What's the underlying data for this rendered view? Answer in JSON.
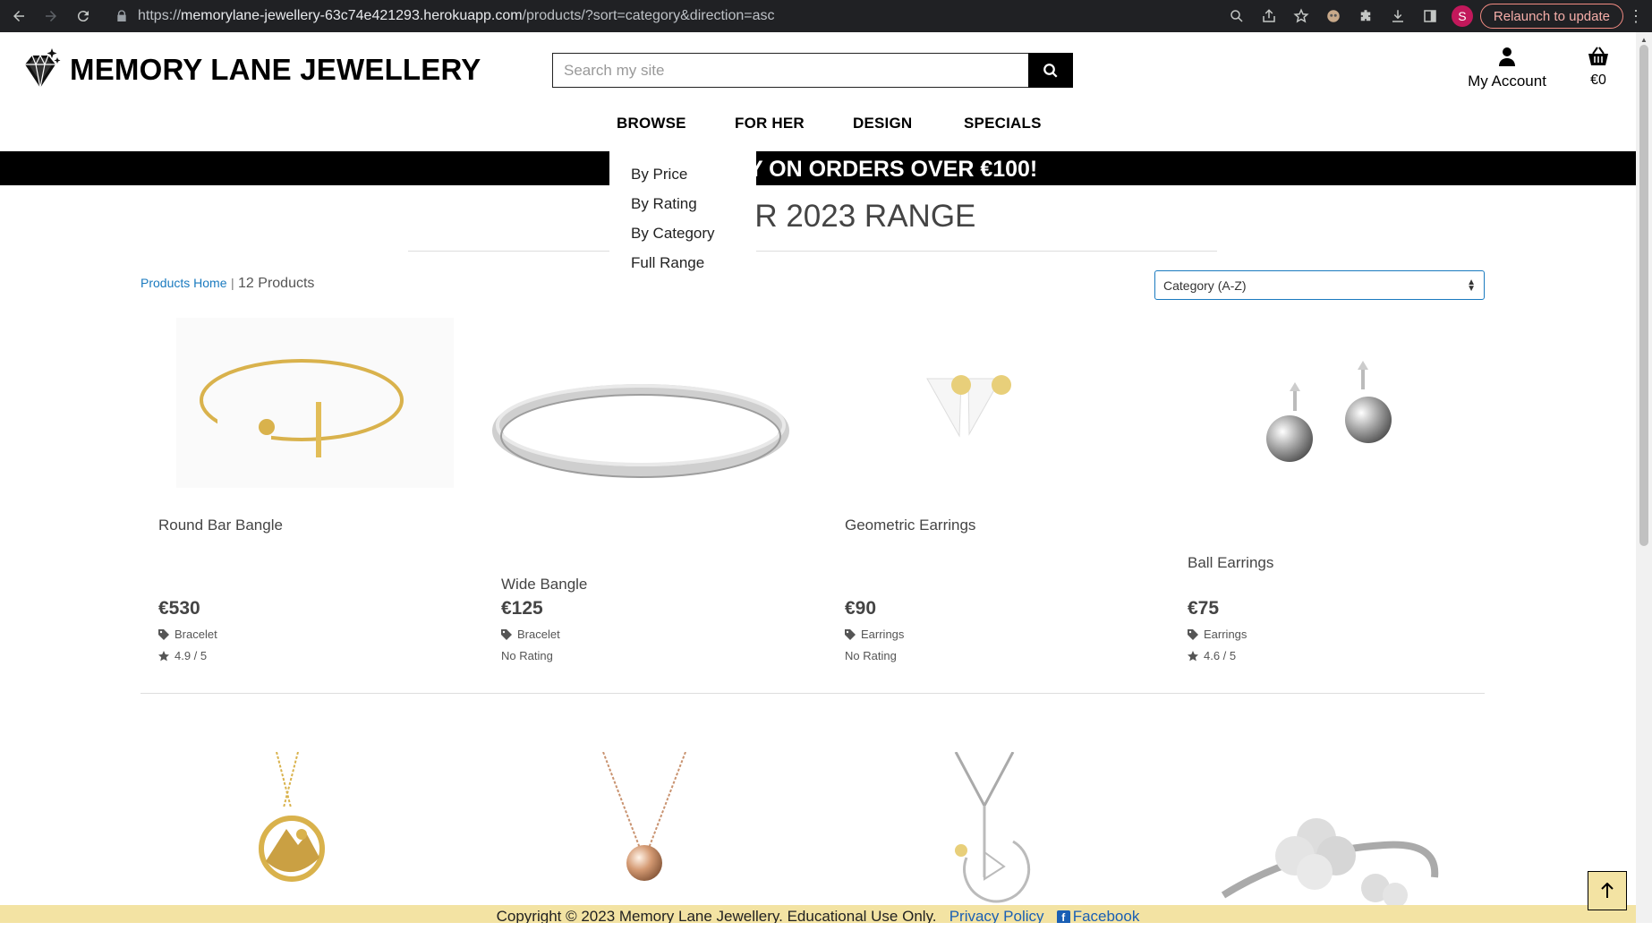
{
  "browser": {
    "url_scheme": "https://",
    "url_host": "memorylane-jewellery-63c74e421293.herokuapp.com",
    "url_path": "/products/?sort=category&direction=asc",
    "profile_initial": "S",
    "relaunch_label": "Relaunch to update"
  },
  "header": {
    "brand": "MEMORY LANE JEWELLERY",
    "search_placeholder": "Search my site",
    "account_label": "My Account",
    "basket_total": "€0"
  },
  "nav": {
    "items": [
      "BROWSE",
      "FOR HER",
      "DESIGN",
      "SPECIALS"
    ]
  },
  "browse_menu": {
    "items": [
      "By Price",
      "By Rating",
      "By Category",
      "Full Range"
    ]
  },
  "banner": {
    "text": "Y ON ORDERS OVER €100!"
  },
  "page": {
    "heading": "ER 2023 RANGE",
    "breadcrumb_home": "Products Home",
    "breadcrumb_sep": "|",
    "product_count": "12 Products",
    "sort_selected": "Category (A-Z)"
  },
  "products": [
    {
      "name": "Round Bar Bangle",
      "price": "€530",
      "category": "Bracelet",
      "rating": "4.9 / 5"
    },
    {
      "name": "Wide Bangle",
      "price": "€125",
      "category": "Bracelet",
      "rating": "No Rating"
    },
    {
      "name": "Geometric Earrings",
      "price": "€90",
      "category": "Earrings",
      "rating": "No Rating"
    },
    {
      "name": "Ball Earrings",
      "price": "€75",
      "category": "Earrings",
      "rating": "4.6 / 5"
    }
  ],
  "footer": {
    "copyright": "Copyright © 2023 Memory Lane Jewellery.   Educational Use Only.",
    "privacy_label": "Privacy Policy",
    "facebook_label": "Facebook"
  },
  "colors": {
    "link": "#1a7abf",
    "footer_bg": "#f3e3a3",
    "banner_bg": "#000000",
    "chrome_bg": "#202124"
  }
}
